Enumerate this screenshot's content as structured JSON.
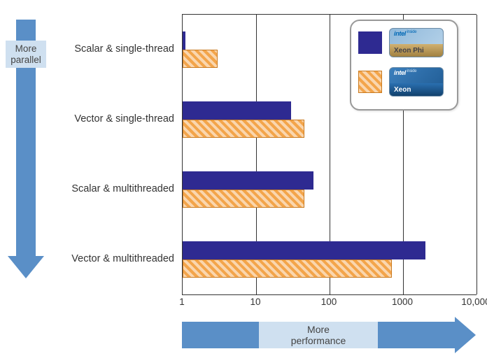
{
  "axis_arrows": {
    "vertical_label": "More\nparallel",
    "horizontal_label": "More\nperformance"
  },
  "legend": {
    "phi": {
      "brand": "intel",
      "inside": "inside",
      "product": "Xeon Phi"
    },
    "xeon": {
      "brand": "intel",
      "inside": "inside",
      "product": "Xeon"
    }
  },
  "ticks": {
    "t0": "1",
    "t1": "10",
    "t2": "100",
    "t3": "1000",
    "t4": "10,000"
  },
  "ylabels": {
    "c0": "Scalar & single-thread",
    "c1": "Vector & single-thread",
    "c2": "Scalar & multithreaded",
    "c3": "Vector & multithreaded"
  },
  "chart_data": {
    "type": "bar",
    "orientation": "horizontal",
    "x_scale": "log10",
    "xlim": [
      1,
      10000
    ],
    "xlabel": "More performance",
    "ylabel": "More parallel",
    "x_ticks": [
      1,
      10,
      100,
      1000,
      10000
    ],
    "categories": [
      "Scalar & single-thread",
      "Vector & single-thread",
      "Scalar & multithreaded",
      "Vector & multithreaded"
    ],
    "series": [
      {
        "name": "Xeon Phi",
        "color": "#2e2a91",
        "values": [
          1.1,
          30,
          60,
          2000
        ]
      },
      {
        "name": "Xeon",
        "color": "#f3a54b",
        "values": [
          3.0,
          45,
          45,
          700
        ]
      }
    ],
    "legend_position": "upper right"
  }
}
